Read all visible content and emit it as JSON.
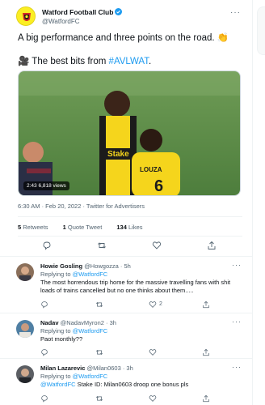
{
  "main_tweet": {
    "author_name": "Watford Football Club",
    "author_handle": "@WatfordFC",
    "text_line1": "A big performance and three points on the road. 👏",
    "text_line2_prefix": "🎥 The best bits from ",
    "hashtag": "#AVLWAT",
    "text_line2_suffix": ".",
    "media_badge": "2:43  6,818 views",
    "jersey_sponsor": "Stake",
    "jersey_name": "LOUZA",
    "time": "6:30 AM · Feb 20, 2022 · ",
    "source": "Twitter for Advertisers",
    "stats": {
      "retweets": "5",
      "retweets_label": "Retweets",
      "quotes": "1",
      "quotes_label": "Quote Tweet",
      "likes": "134",
      "likes_label": "Likes"
    },
    "colors": {
      "brand_yellow": "#fbee23",
      "accent": "#1d9bf0"
    }
  },
  "replies": [
    {
      "name": "Howie Gosling",
      "handle": "@Howgozza · 5h",
      "replying_label": "Replying to ",
      "replying_to": "@WatfordFC",
      "line1": "The most horrendous trip home for the massive travelling fans with shit",
      "line2": "loads of trains cancelled but no one thinks about them.....",
      "like_count": "2"
    },
    {
      "name": "Nadav",
      "handle": "@NadavMyron2 · 3h",
      "replying_label": "Replying to ",
      "replying_to": "@WatfordFC",
      "line1": "Paot monthly??"
    },
    {
      "name": "Milan Lazarevic",
      "handle": "@Milan0603 · 3h",
      "replying_label": "Replying to ",
      "replying_to": "@WatfordFC",
      "mention": "@WatfordFC",
      "line1_suffix": " Stake ID: Milan0603 droop one bonus pls"
    }
  ]
}
